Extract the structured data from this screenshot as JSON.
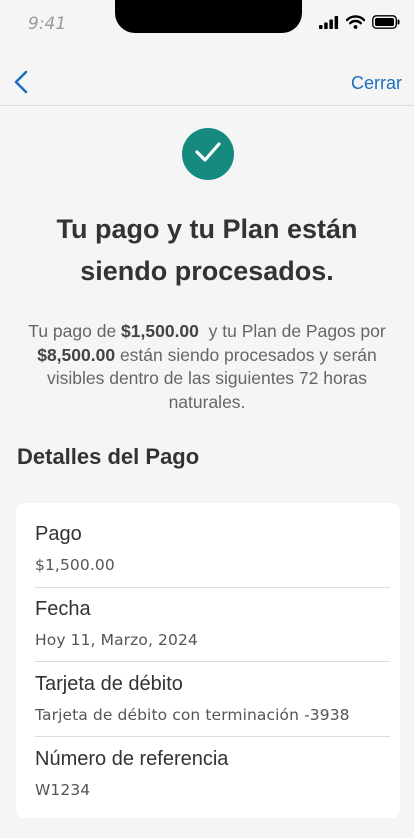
{
  "status_bar": {
    "time": "9:41",
    "icons": [
      "cellular-signal-icon",
      "wifi-icon",
      "battery-icon"
    ]
  },
  "nav": {
    "back_icon": "chevron-left-icon",
    "close_label": "Cerrar"
  },
  "success_icon": "checkmark-icon",
  "title": "Tu pago y tu Plan están siendo procesados.",
  "summary": {
    "prefix": "Tu pago de ",
    "payment_amount": "$1,500.00",
    "middle": "  y tu Plan de Pagos por ",
    "plan_amount": "$8,500.00",
    "suffix": " están siendo procesados y serán visibles dentro de las siguientes 72 horas naturales."
  },
  "details": {
    "section_title": "Detalles del Pago",
    "rows": [
      {
        "label": "Pago",
        "value": "$1,500.00"
      },
      {
        "label": "Fecha",
        "value": "Hoy 11, Marzo, 2024"
      },
      {
        "label": "Tarjeta de débito",
        "value": "Tarjeta de débito con terminación -3938"
      },
      {
        "label": "Número de referencia",
        "value": "W1234"
      }
    ]
  },
  "colors": {
    "accent_teal": "#178a80",
    "link_blue": "#1a6fc0"
  }
}
